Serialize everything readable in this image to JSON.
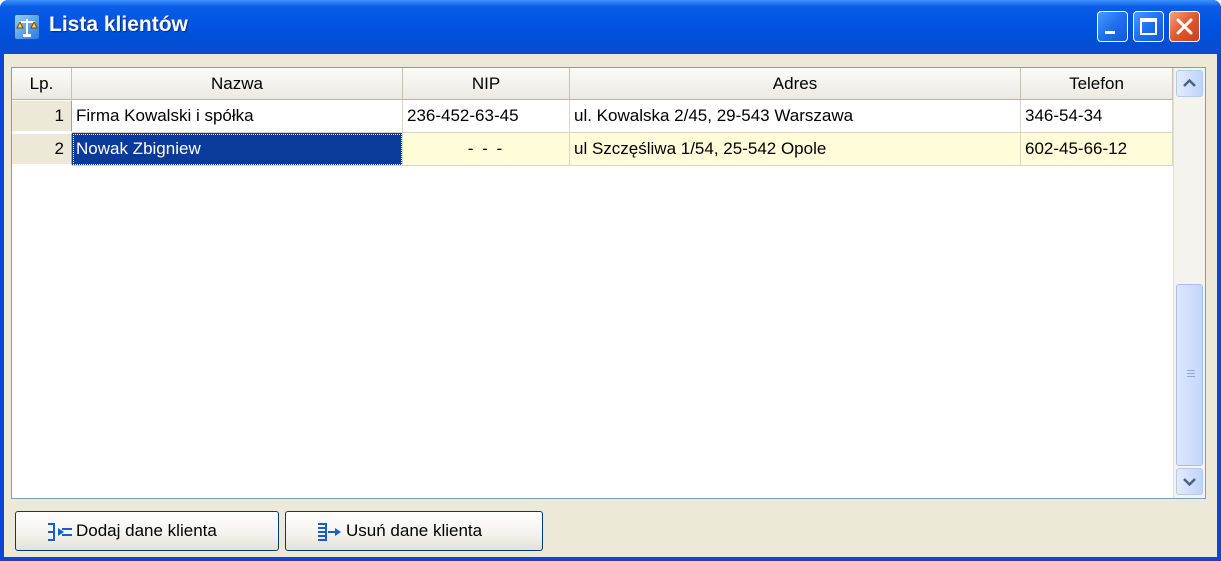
{
  "window": {
    "title": "Lista klientów",
    "icons": {
      "app": "scales-icon",
      "minimize": "minimize-icon",
      "maximize": "maximize-icon",
      "close": "close-icon"
    }
  },
  "grid": {
    "columns": [
      "Lp.",
      "Nazwa",
      "NIP",
      "Adres",
      "Telefon"
    ],
    "rows": [
      {
        "lp": "1",
        "nazwa": "Firma Kowalski i spółka",
        "nip": "236-452-63-45",
        "adres": "ul. Kowalska 2/45, 29-543 Warszawa",
        "telefon": "346-54-34"
      },
      {
        "lp": "2",
        "nazwa": "Nowak Zbigniew",
        "nip": "- - -",
        "adres": "ul Szczęśliwa 1/54, 25-542 Opole",
        "telefon": "602-45-66-12"
      }
    ],
    "selected_row": 2,
    "colors": {
      "selection": "#0a3a9a",
      "edit_row": "#fffcd9"
    }
  },
  "buttons": {
    "add": {
      "label": "Dodaj dane klienta",
      "icon": "add-record-icon"
    },
    "delete": {
      "label": "Usuń dane klienta",
      "icon": "remove-record-icon"
    }
  },
  "colors": {
    "titlebar": "#0054e3",
    "close_button": "#e2572a",
    "face": "#ece9d8"
  }
}
